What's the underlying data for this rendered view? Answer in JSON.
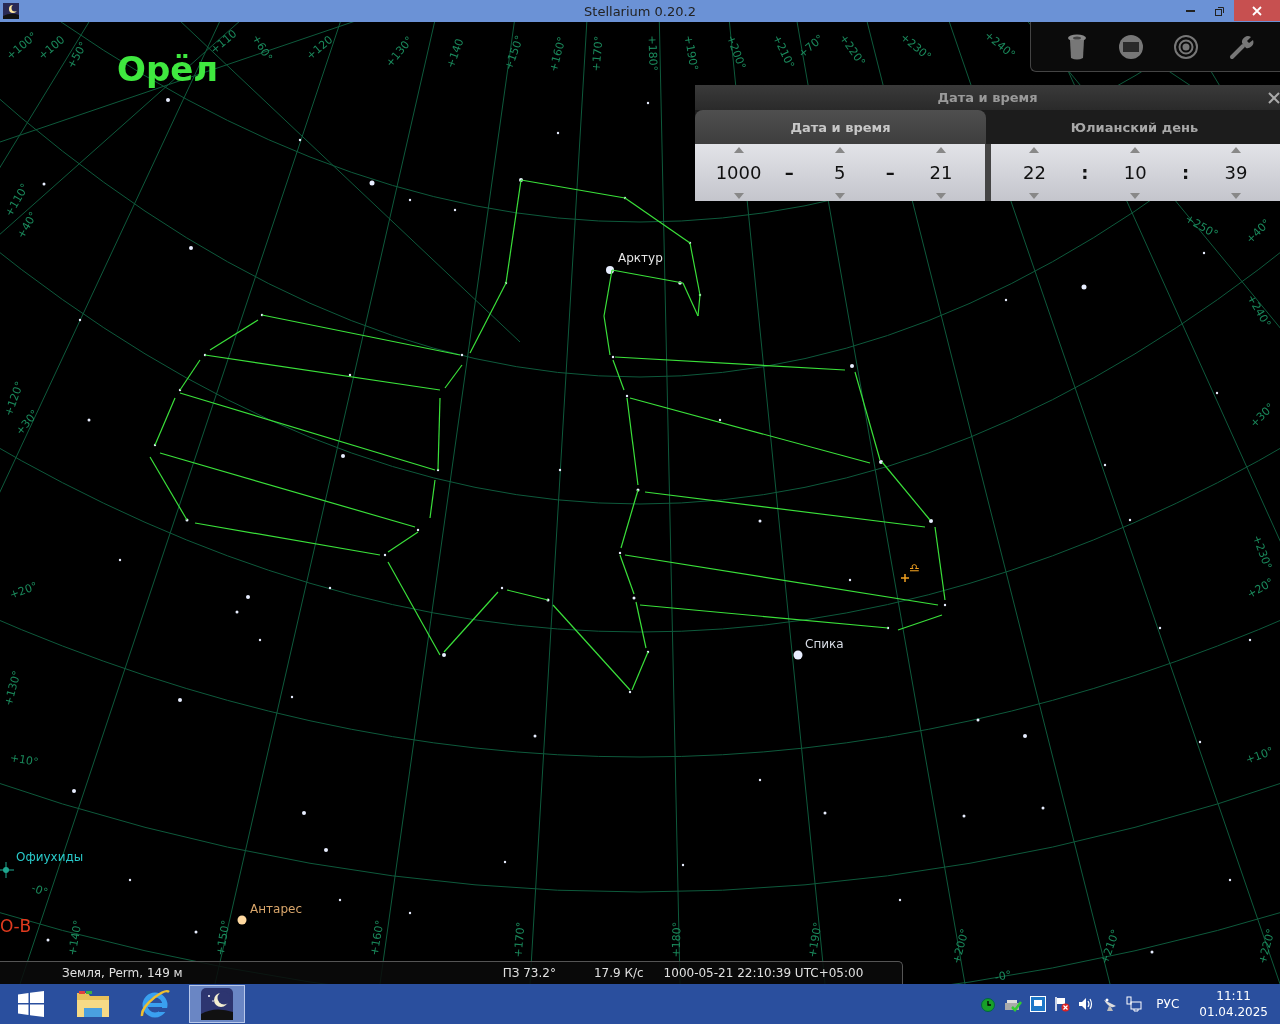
{
  "window": {
    "title": "Stellarium 0.20.2"
  },
  "sky": {
    "constellation_name": "Орёл",
    "labels": [
      {
        "text": "Арктур",
        "color": "#e6e6e6"
      },
      {
        "text": "Спика",
        "color": "#d8dde6"
      },
      {
        "text": "Антарес",
        "color": "#d9a66b"
      },
      {
        "text": "Офиухиды",
        "color": "#29c9c9"
      },
      {
        "text": "О-В",
        "color": "#e03a1e"
      },
      {
        "text": "♎",
        "color": "#f0a020"
      }
    ],
    "grid_labels": [
      "+100°",
      "+100",
      "+50°",
      "+110",
      "+60°",
      "+120",
      "+130°",
      "+140",
      "+150°",
      "+160°",
      "+170°",
      "+180°",
      "+190°",
      "+200°",
      "+210°",
      "+70°",
      "+220°",
      "+230°",
      "+240°",
      "+250°",
      "+110°",
      "+40°",
      "+120°",
      "+30°",
      "+20°",
      "+130°",
      "+10°",
      "-0°",
      "+40°",
      "+240°",
      "+30°",
      "+230°",
      "+20°",
      "+10°",
      "+220°",
      "+140°",
      "+150°",
      "+160°",
      "+170°",
      "+180°",
      "+190°",
      "+200°",
      "-0°",
      "+210°"
    ]
  },
  "date_dialog": {
    "title": "Дата и время",
    "tabs": [
      {
        "label": "Дата и время",
        "selected": true
      },
      {
        "label": "Юлианский день",
        "selected": false
      }
    ],
    "date_fields": [
      {
        "value": "1000",
        "separator": "–"
      },
      {
        "value": "5",
        "separator": "–"
      },
      {
        "value": "21"
      }
    ],
    "time_fields": [
      {
        "value": "22",
        "separator": ":"
      },
      {
        "value": "10",
        "separator": ":"
      },
      {
        "value": "39"
      }
    ]
  },
  "status_bar": {
    "location": "Земля, Perm, 149 м",
    "fov": "ПЗ 73.2°",
    "fps": "17.9 К/с",
    "datetime": "1000-05-21 22:10:39 UTC+05:00"
  },
  "taskbar": {
    "apps": [
      {
        "kind": "start",
        "selected": false
      },
      {
        "kind": "explorer",
        "selected": false
      },
      {
        "kind": "browser",
        "selected": false
      },
      {
        "kind": "stellarium",
        "selected": true
      }
    ],
    "language": "РУС",
    "time": "11:11",
    "date": "01.04.2025"
  }
}
